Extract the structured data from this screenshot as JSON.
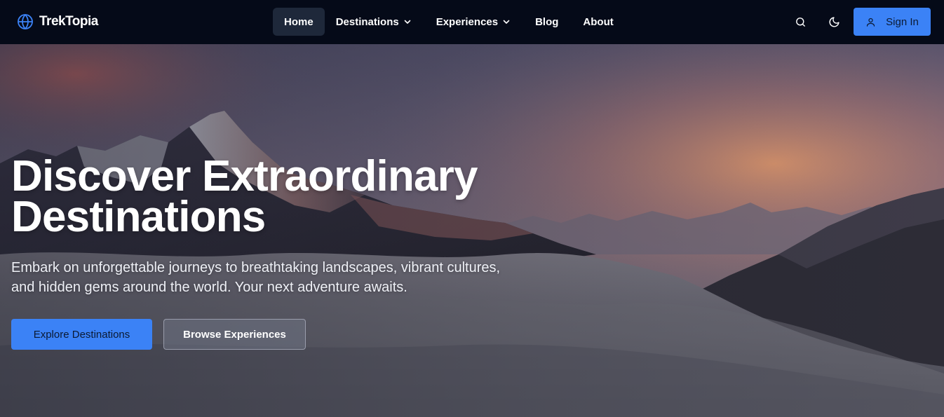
{
  "brand": {
    "name": "TrekTopia",
    "logo_icon": "globe-icon",
    "accent_color": "#3b82f6"
  },
  "nav": {
    "items": [
      {
        "label": "Home",
        "active": true,
        "has_dropdown": false
      },
      {
        "label": "Destinations",
        "active": false,
        "has_dropdown": true
      },
      {
        "label": "Experiences",
        "active": false,
        "has_dropdown": true
      },
      {
        "label": "Blog",
        "active": false,
        "has_dropdown": false
      },
      {
        "label": "About",
        "active": false,
        "has_dropdown": false
      }
    ],
    "search_icon": "search-icon",
    "theme_icon": "moon-icon",
    "sign_in_label": "Sign In",
    "sign_in_icon": "user-icon"
  },
  "hero": {
    "title_line1": "Discover Extraordinary",
    "title_line2": "Destinations",
    "subtitle_line1": "Embark on unforgettable journeys to breathtaking landscapes, vibrant cultures,",
    "subtitle_line2": "and hidden gems around the world. Your next adventure awaits.",
    "primary_cta": "Explore Destinations",
    "secondary_cta": "Browse Experiences",
    "background": "mountain peaks above a sea of clouds at sunset"
  }
}
